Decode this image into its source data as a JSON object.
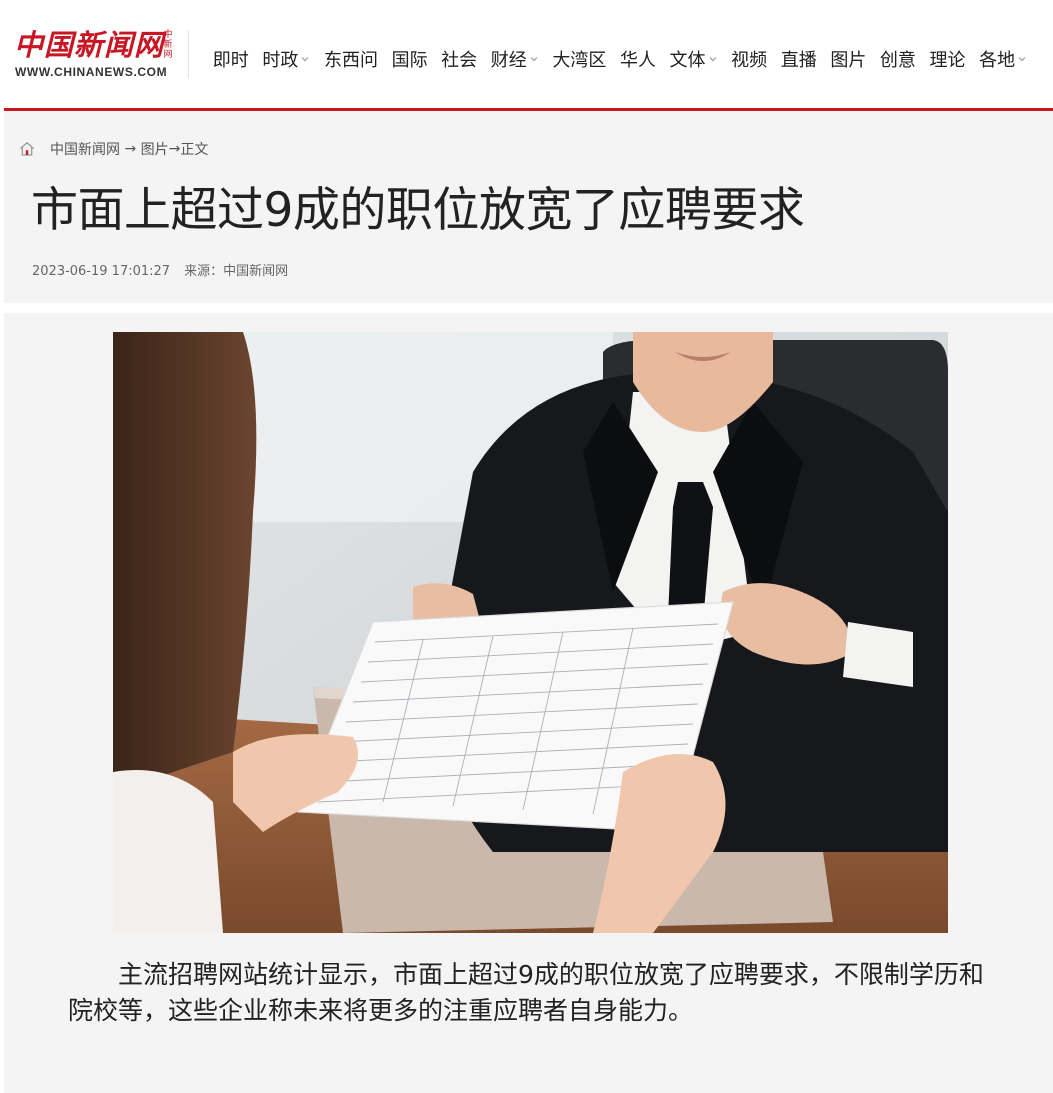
{
  "brand": {
    "logo_cn": "中国新闻网",
    "logo_vertical": "中新网",
    "logo_en": "WWW.CHINANEWS.COM",
    "accent_color": "#c81623"
  },
  "nav": {
    "items": [
      {
        "label": "即时",
        "dropdown": false
      },
      {
        "label": "时政",
        "dropdown": true
      },
      {
        "label": "东西问",
        "dropdown": false
      },
      {
        "label": "国际",
        "dropdown": false
      },
      {
        "label": "社会",
        "dropdown": false
      },
      {
        "label": "财经",
        "dropdown": true
      },
      {
        "label": "大湾区",
        "dropdown": false
      },
      {
        "label": "华人",
        "dropdown": false
      },
      {
        "label": "文体",
        "dropdown": true
      },
      {
        "label": "视频",
        "dropdown": false
      },
      {
        "label": "直播",
        "dropdown": false
      },
      {
        "label": "图片",
        "dropdown": false
      },
      {
        "label": "创意",
        "dropdown": false
      },
      {
        "label": "理论",
        "dropdown": false
      },
      {
        "label": "各地",
        "dropdown": true
      }
    ]
  },
  "breadcrumb": {
    "home_icon": "home-icon",
    "site": "中国新闻网",
    "arrow1": " → ",
    "section": "图片",
    "arrow2": "→",
    "current": "正文"
  },
  "article": {
    "title": "市面上超过9成的职位放宽了应聘要求",
    "datetime": "2023-06-19 17:01:27",
    "source_label": "来源：",
    "source": "中国新闻网",
    "image_alt": "求职者递交简历给面试官",
    "caption": "主流招聘网站统计显示，市面上超过9成的职位放宽了应聘要求，不限制学历和院校等，这些企业称未来将更多的注重应聘者自身能力。"
  }
}
